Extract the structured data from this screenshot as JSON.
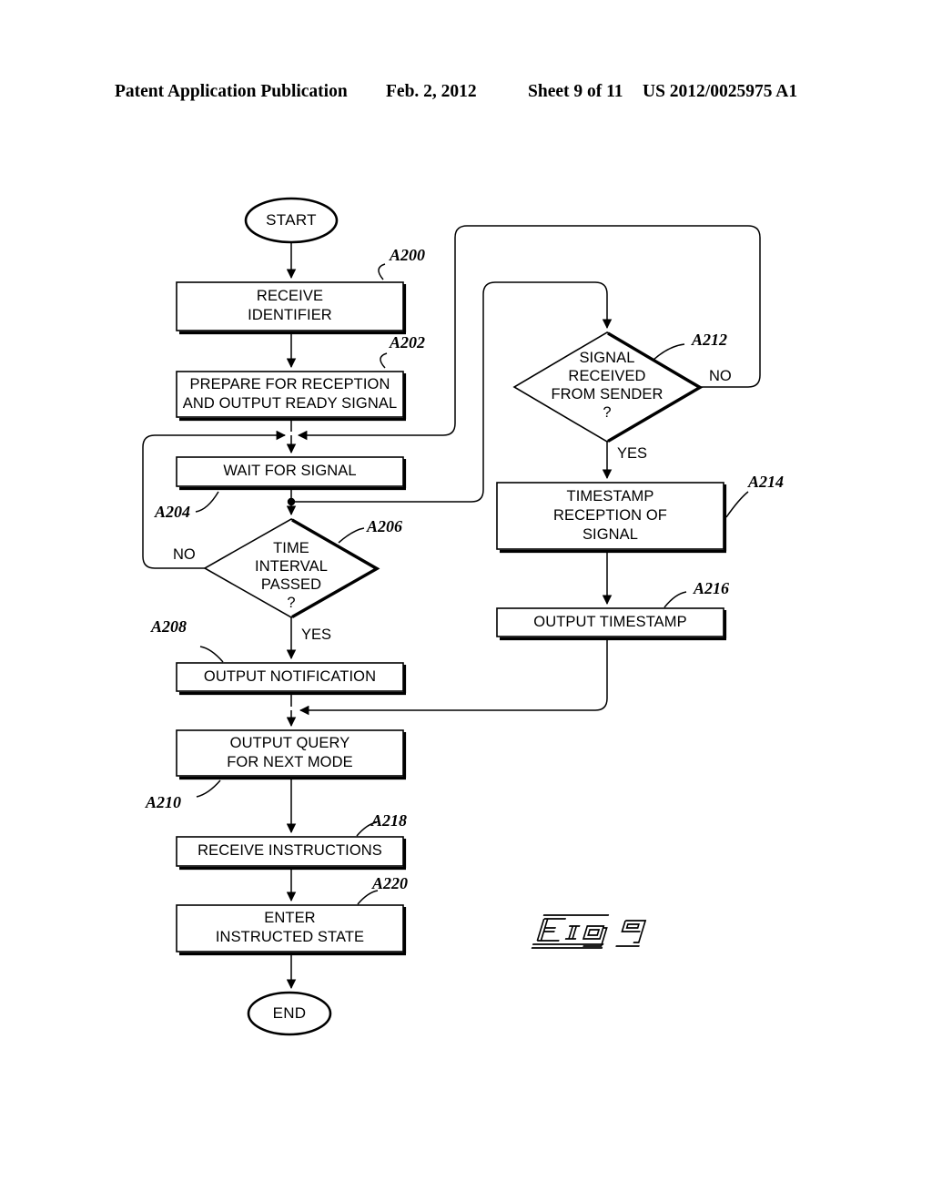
{
  "header": {
    "publication": "Patent Application Publication",
    "date": "Feb. 2, 2012",
    "sheet": "Sheet 9 of 11",
    "patent_number": "US 2012/0025975 A1"
  },
  "figure": {
    "caption": "Fig 9",
    "caption_style": "outlined-italic-3d"
  },
  "flowchart": {
    "terminals": [
      {
        "id": "start",
        "label": "START"
      },
      {
        "id": "end",
        "label": "END"
      }
    ],
    "processes": [
      {
        "ref": "A200",
        "label": "RECEIVE\nIDENTIFIER"
      },
      {
        "ref": "A202",
        "label": "PREPARE FOR RECEPTION\nAND OUTPUT READY SIGNAL"
      },
      {
        "ref": "A204",
        "label": "WAIT FOR SIGNAL"
      },
      {
        "ref": "A208",
        "label": "OUTPUT NOTIFICATION"
      },
      {
        "ref": "A210",
        "label": "OUTPUT QUERY\nFOR NEXT MODE"
      },
      {
        "ref": "A214",
        "label": "TIMESTAMP\nRECEPTION OF\nSIGNAL"
      },
      {
        "ref": "A216",
        "label": "OUTPUT TIMESTAMP"
      },
      {
        "ref": "A218",
        "label": "RECEIVE INSTRUCTIONS"
      },
      {
        "ref": "A220",
        "label": "ENTER\nINSTRUCTED STATE"
      }
    ],
    "decisions": [
      {
        "ref": "A206",
        "label": "TIME\nINTERVAL\nPASSED\n?",
        "yes_label": "YES",
        "no_label": "NO"
      },
      {
        "ref": "A212",
        "label": "SIGNAL\nRECEIVED\nFROM SENDER\n?",
        "yes_label": "YES",
        "no_label": "NO"
      }
    ],
    "refs": {
      "a200": "A200",
      "a202": "A202",
      "a204": "A204",
      "a206": "A206",
      "a208": "A208",
      "a210": "A210",
      "a212": "A212",
      "a214": "A214",
      "a216": "A216",
      "a218": "A218",
      "a220": "A220"
    },
    "branch_text": {
      "a206_no": "NO",
      "a206_yes": "YES",
      "a212_no": "NO",
      "a212_yes": "YES"
    }
  },
  "colors": {
    "ink": "#000000",
    "paper": "#ffffff"
  }
}
